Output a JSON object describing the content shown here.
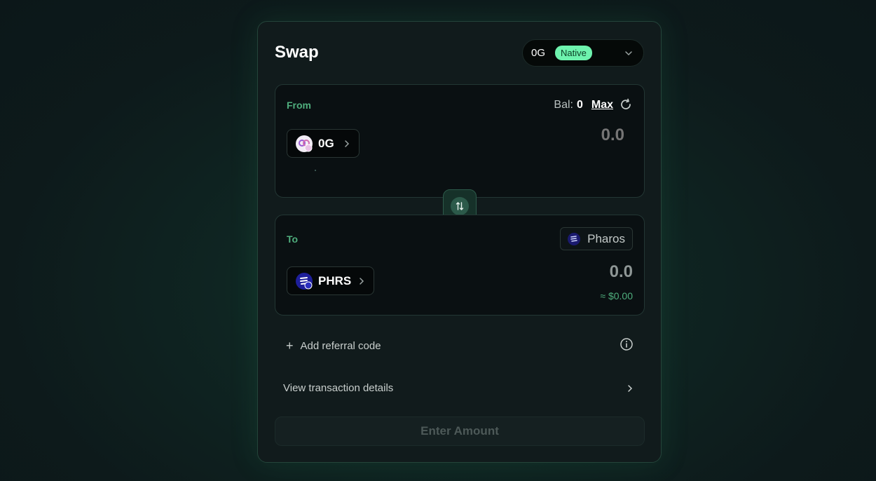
{
  "header": {
    "title": "Swap"
  },
  "chain_selector": {
    "name": "0G",
    "badge": "Native"
  },
  "from": {
    "label": "From",
    "balance_label": "Bal:",
    "balance_value": "0",
    "max_label": "Max",
    "token": "0G",
    "amount": "0.0"
  },
  "to": {
    "label": "To",
    "network": "Pharos",
    "token": "PHRS",
    "amount": "0.0",
    "usd_value": "≈ $0.00"
  },
  "referral": {
    "label": "Add referral code"
  },
  "details": {
    "label": "View transaction details"
  },
  "submit": {
    "label": "Enter Amount"
  },
  "colors": {
    "accent": "#4fae7d",
    "badge": "#6ef3ae",
    "card_bg": "#111b1c"
  }
}
